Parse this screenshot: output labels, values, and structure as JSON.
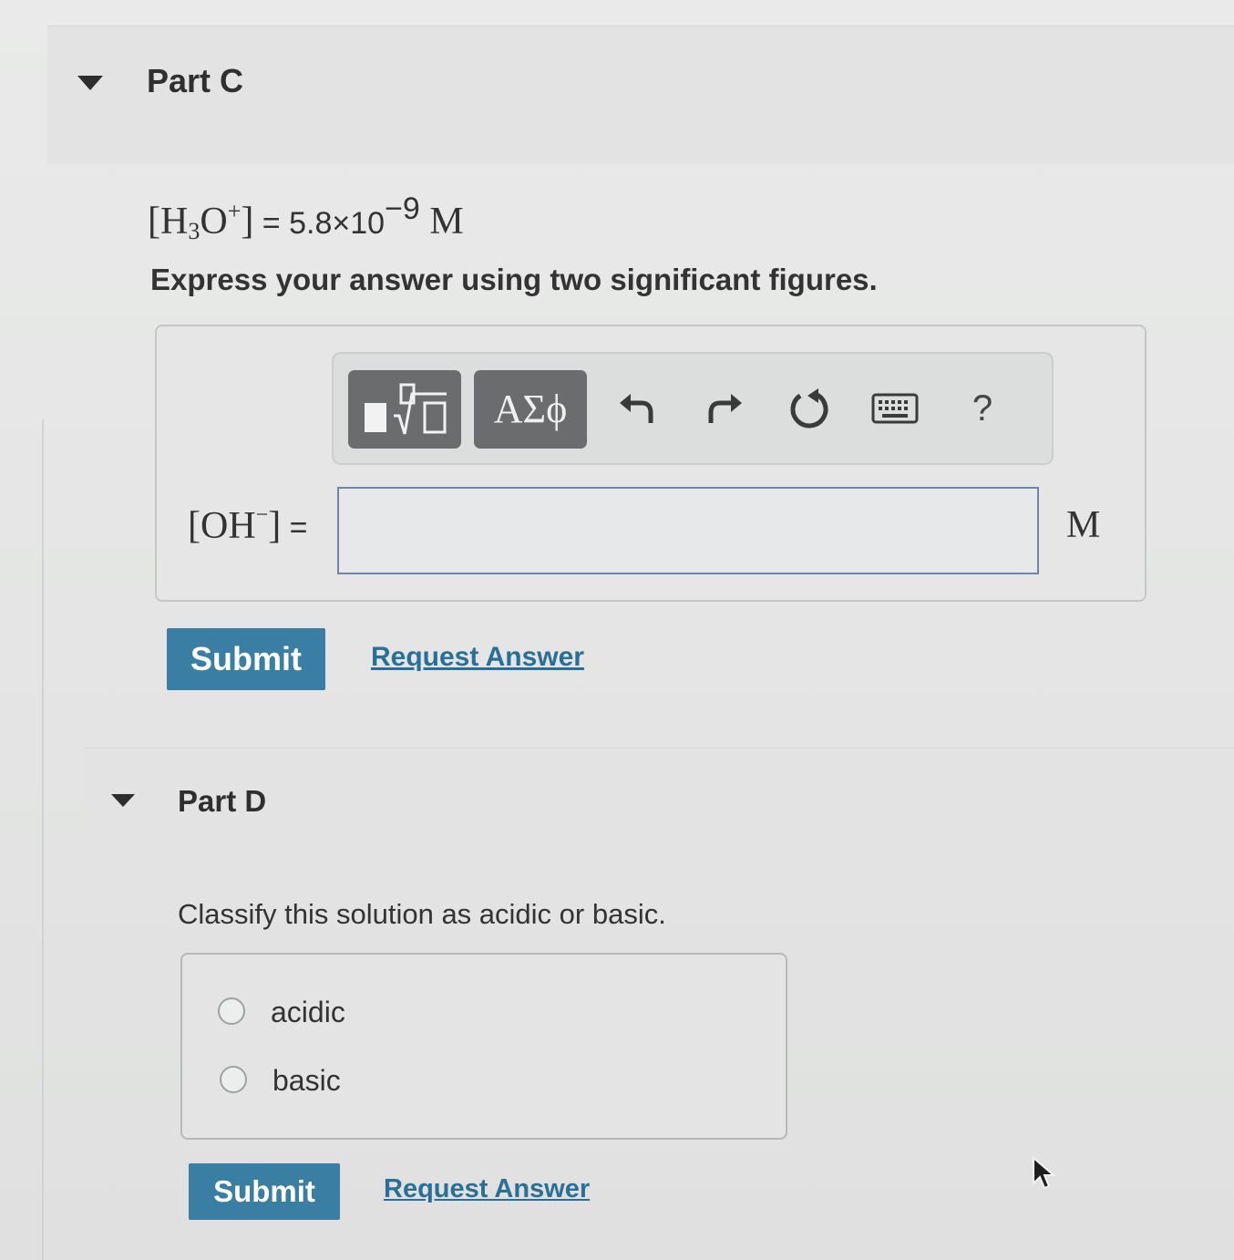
{
  "part_c": {
    "title": "Part C",
    "given": {
      "species": "H",
      "sub": "3",
      "species2": "O",
      "charge": "+",
      "equals": " = ",
      "mantissa": "5.8×10",
      "exponent": "−9",
      "unit": "M"
    },
    "instruction": "Express your answer using two significant figures.",
    "toolbar": {
      "symbols_label": "ΑΣϕ",
      "help_label": "?"
    },
    "answer": {
      "lhs_open": "[OH",
      "lhs_charge": "−",
      "lhs_close": "]",
      "equals": " = ",
      "value": "",
      "unit": "M"
    },
    "submit_label": "Submit",
    "request_label": "Request Answer"
  },
  "part_d": {
    "title": "Part D",
    "question": "Classify this solution as acidic or basic.",
    "options": [
      {
        "label": "acidic",
        "selected": false
      },
      {
        "label": "basic",
        "selected": false
      }
    ],
    "submit_label": "Submit",
    "request_label": "Request Answer"
  },
  "colors": {
    "submit": "#3a7fa3",
    "link": "#2a6f95",
    "toolbar_button": "#6b6c6d"
  }
}
